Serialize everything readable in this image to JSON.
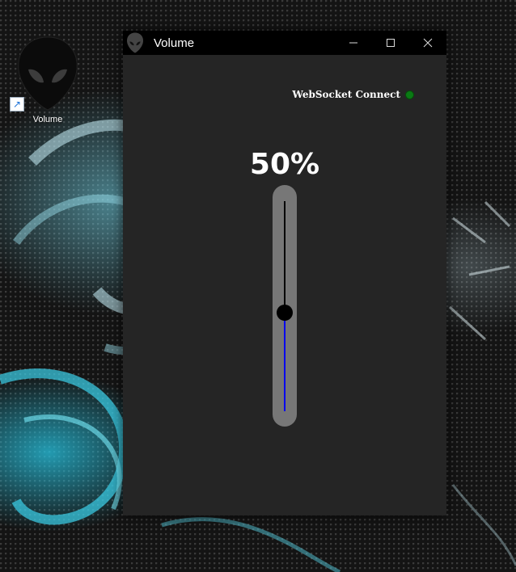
{
  "desktop": {
    "icon_label": "Volume",
    "icon_name": "alien-head-icon"
  },
  "window": {
    "title": "Volume",
    "icon_name": "alien-head-icon",
    "controls": {
      "minimize_icon": "minimize-icon",
      "maximize_icon": "maximize-icon",
      "close_icon": "close-icon"
    }
  },
  "status": {
    "label": "WebSocket Connect",
    "indicator_color": "#0a7a14"
  },
  "volume": {
    "display": "50%",
    "level": 0.5
  },
  "colors": {
    "window_bg": "#252525",
    "titlebar_bg": "#000000",
    "slider_track": "#777777",
    "slider_fill": "#0000ee",
    "slider_thumb": "#000000"
  }
}
